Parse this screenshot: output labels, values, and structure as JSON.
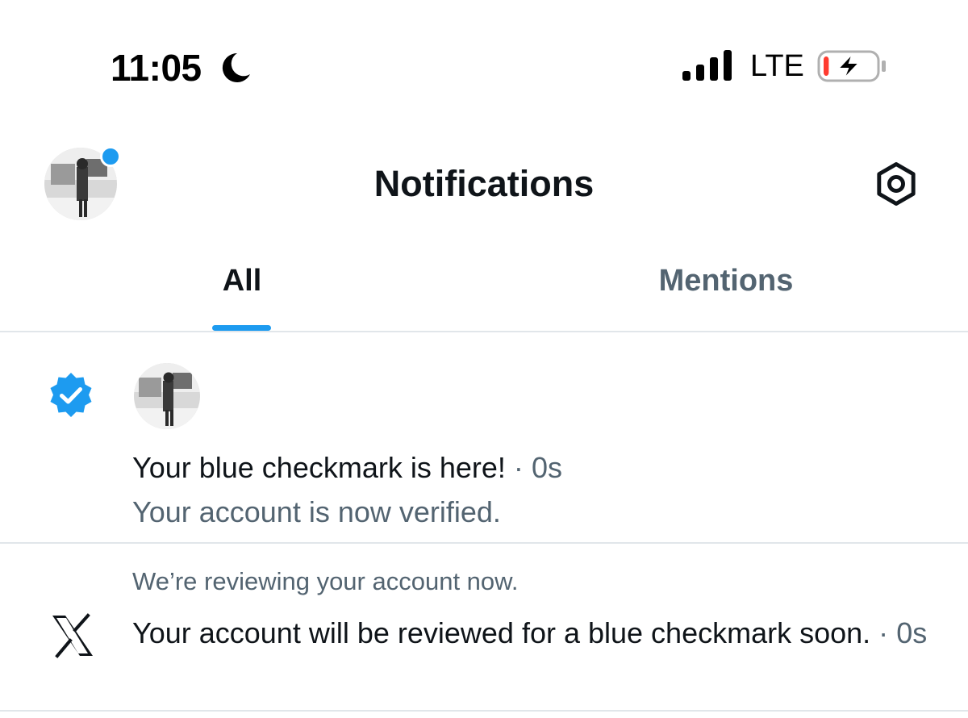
{
  "status_bar": {
    "time": "11:05",
    "focus_icon": "moon-icon",
    "signal_icon": "cellular-signal-icon",
    "network": "LTE",
    "battery_icon": "battery-charging-icon",
    "battery_level": 0.1
  },
  "header": {
    "avatar_icon": "profile-avatar",
    "title": "Notifications",
    "settings_icon": "gear-icon"
  },
  "tabs": [
    {
      "label": "All",
      "active": true
    },
    {
      "label": "Mentions",
      "active": false
    }
  ],
  "notifications": [
    {
      "icon": "verified-badge-icon",
      "title": "Your blue checkmark is here!",
      "separator": "·",
      "time": "0s",
      "subtitle": "Your account is now verified."
    },
    {
      "icon": "x-logo-icon",
      "context": "We’re reviewing your account now.",
      "text": "Your account will be reviewed for a blue checkmark soon.",
      "separator": "·",
      "time": "0s"
    }
  ],
  "colors": {
    "accent": "#1d9bf0",
    "text_primary": "#0f1419",
    "text_secondary": "#536471",
    "divider": "#e1e6ea",
    "battery_low": "#ff3b30"
  }
}
